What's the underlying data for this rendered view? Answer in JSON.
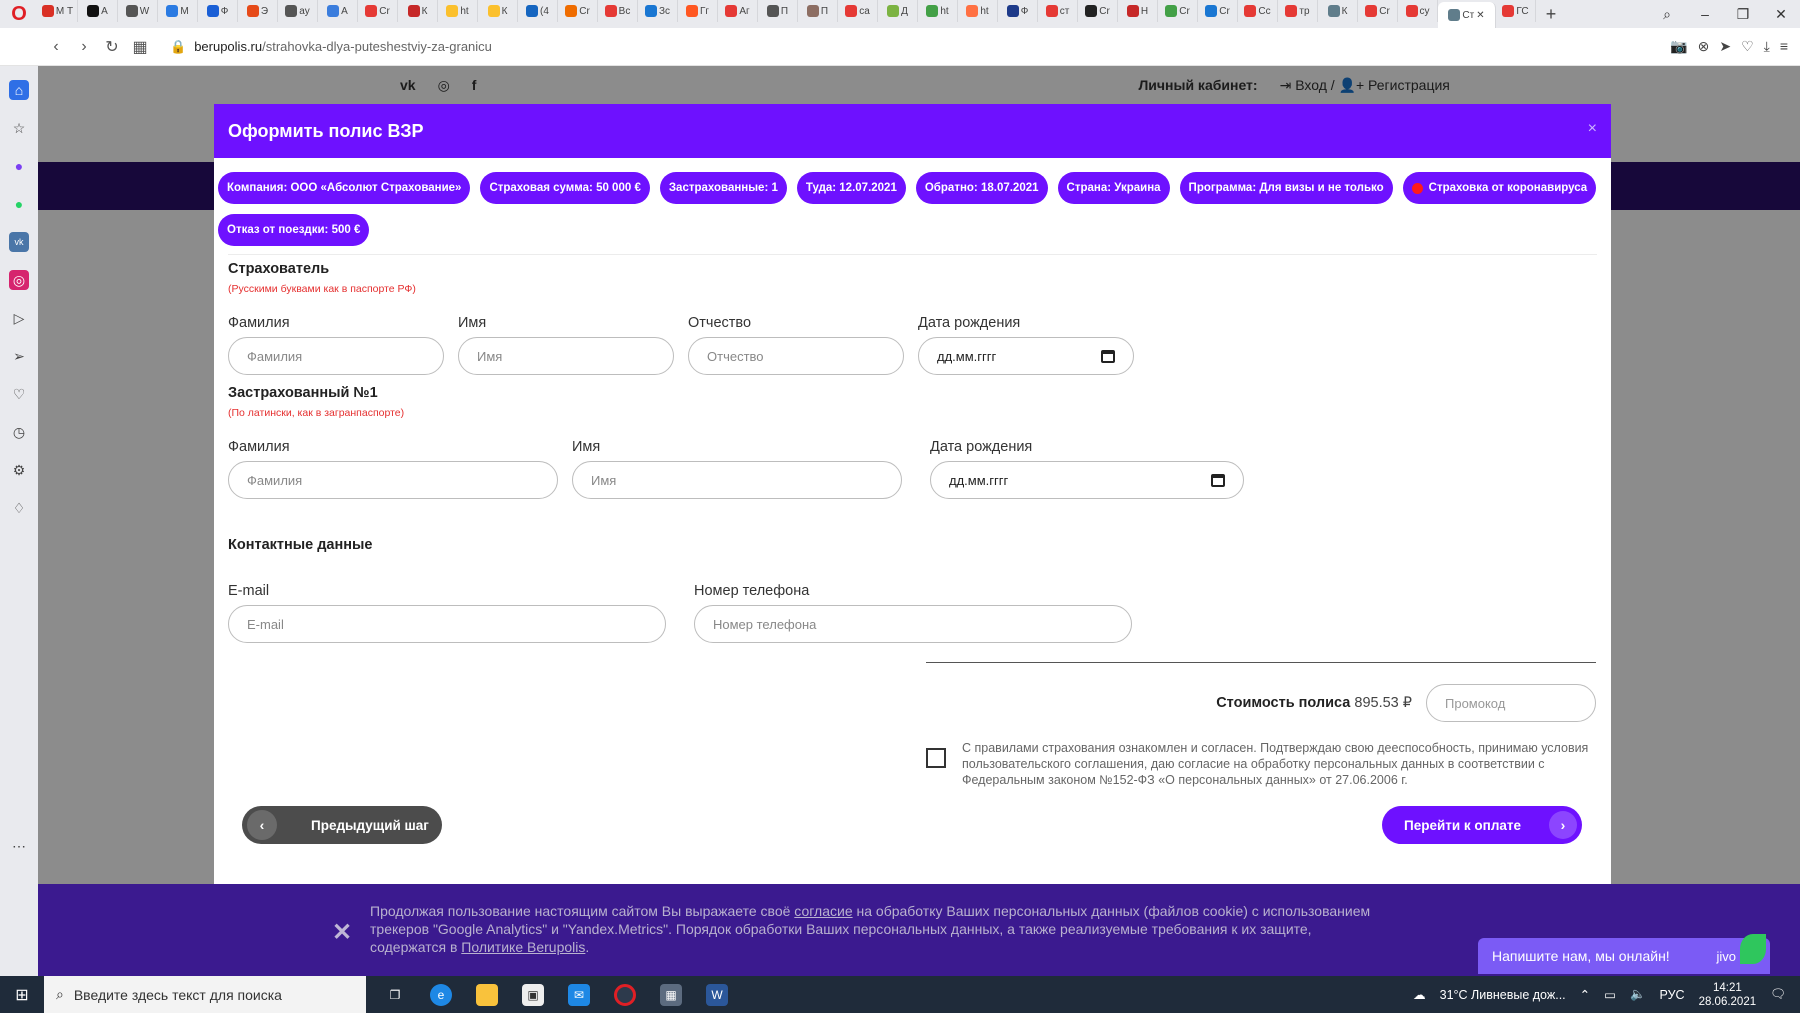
{
  "browser": {
    "tabs": [
      {
        "label": "M Т",
        "color": "#d93025"
      },
      {
        "label": "A",
        "color": "#111111"
      },
      {
        "label": "W",
        "color": "#555555"
      },
      {
        "label": "М",
        "color": "#2a7ae2"
      },
      {
        "label": "Ф",
        "color": "#1a5fd6"
      },
      {
        "label": "Э",
        "color": "#e64a19"
      },
      {
        "label": "ау",
        "color": "#555555"
      },
      {
        "label": "А",
        "color": "#3b7ddd"
      },
      {
        "label": "Cr",
        "color": "#e53935"
      },
      {
        "label": "К",
        "color": "#c62828"
      },
      {
        "label": "ht",
        "color": "#fbc02d"
      },
      {
        "label": "К",
        "color": "#fbc02d"
      },
      {
        "label": "(4",
        "color": "#1565c0"
      },
      {
        "label": "Cr",
        "color": "#ef6c00"
      },
      {
        "label": "Вс",
        "color": "#e53935"
      },
      {
        "label": "Зс",
        "color": "#1976d2"
      },
      {
        "label": "Гг",
        "color": "#ff5722"
      },
      {
        "label": "Аг",
        "color": "#e53935"
      },
      {
        "label": "П",
        "color": "#555555"
      },
      {
        "label": "П",
        "color": "#8d6e63"
      },
      {
        "label": "са",
        "color": "#e53935"
      },
      {
        "label": "Д",
        "color": "#7cb342"
      },
      {
        "label": "ht",
        "color": "#43a047"
      },
      {
        "label": "ht",
        "color": "#ff7043"
      },
      {
        "label": "Ф",
        "color": "#1e3a8a"
      },
      {
        "label": "ст",
        "color": "#e53935"
      },
      {
        "label": "Cr",
        "color": "#222222"
      },
      {
        "label": "Н",
        "color": "#c62828"
      },
      {
        "label": "Cr",
        "color": "#43a047"
      },
      {
        "label": "Cr",
        "color": "#1976d2"
      },
      {
        "label": "Сс",
        "color": "#e53935"
      },
      {
        "label": "тр",
        "color": "#e53935"
      },
      {
        "label": "К",
        "color": "#607d8b"
      },
      {
        "label": "Cr",
        "color": "#e53935"
      },
      {
        "label": "су",
        "color": "#e53935"
      },
      {
        "label": "Ст",
        "color": "#607d8b",
        "active": true
      },
      {
        "label": "ГС",
        "color": "#e53935"
      }
    ],
    "new_tab": "+",
    "url_host": "berupolis.ru",
    "url_path": "/strahovka-dlya-puteshestviy-za-granicu"
  },
  "site_header": {
    "cabinet_label": "Личный кабинет:",
    "login": "Вход",
    "separator": "/",
    "register": "Регистрация"
  },
  "modal": {
    "title": "Оформить полис ВЗР",
    "close": "×",
    "chips": [
      "Компания: ООО «Абсолют Страхование»",
      "Страховая сумма: 50 000 €",
      "Застрахованные: 1",
      "Туда: 12.07.2021",
      "Обратно: 18.07.2021",
      "Страна: Украина",
      "Программа: Для визы и не только",
      "Страховка от коронавируса",
      "Отказ от поездки: 500 €"
    ],
    "insurer": {
      "title": "Страхователь",
      "hint": "(Русскими буквами как в паспорте РФ)",
      "fields": [
        {
          "label": "Фамилия",
          "placeholder": "Фамилия"
        },
        {
          "label": "Имя",
          "placeholder": "Имя"
        },
        {
          "label": "Отчество",
          "placeholder": "Отчество"
        },
        {
          "label": "Дата рождения",
          "placeholder": "дд.мм.гггг"
        }
      ]
    },
    "insured": {
      "title": "Застрахованный №1",
      "hint": "(По латински, как в загранпаспорте)",
      "fields": [
        {
          "label": "Фамилия",
          "placeholder": "Фамилия"
        },
        {
          "label": "Имя",
          "placeholder": "Имя"
        },
        {
          "label": "Дата рождения",
          "placeholder": "дд.мм.гггг"
        }
      ]
    },
    "contacts": {
      "title": "Контактные данные",
      "fields": [
        {
          "label": "E-mail",
          "placeholder": "E-mail"
        },
        {
          "label": "Номер телефона",
          "placeholder": "Номер телефона"
        }
      ]
    },
    "price_label": "Стоимость полиса",
    "price_value": "895.53 ₽",
    "promo_placeholder": "Промокод",
    "agreement": "С правилами страхования ознакомлен и согласен. Подтверждаю свою дееспособность, принимаю условия пользовательского соглашения, даю согласие на обработку персональных данных в соответствии с Федеральным законом №152-ФЗ «О персональных данных» от 27.06.2006 г.",
    "prev_button": "Предыдущий шаг",
    "pay_button": "Перейти к оплате"
  },
  "cookie": {
    "text_1": "Продолжая пользование настоящим сайтом Вы выражаете своё ",
    "link_1": "согласие",
    "text_2": " на обработку Ваших персональных данных (файлов cookie) с использованием трекеров \"Google Analytics\" и \"Yandex.Metrics\". Порядок обработки Ваших персональных данных, а также реализуемые требования к их защите, содержатся в ",
    "link_2": "Политике Berupolis",
    "text_3": "."
  },
  "chat": {
    "label": "Напишите нам, мы онлайн!",
    "brand": "jivo"
  },
  "taskbar": {
    "search_placeholder": "Введите здесь текст для поиска",
    "weather": "31°C  Ливневые дож...",
    "lang": "РУС",
    "time": "14:21",
    "date": "28.06.2021"
  }
}
